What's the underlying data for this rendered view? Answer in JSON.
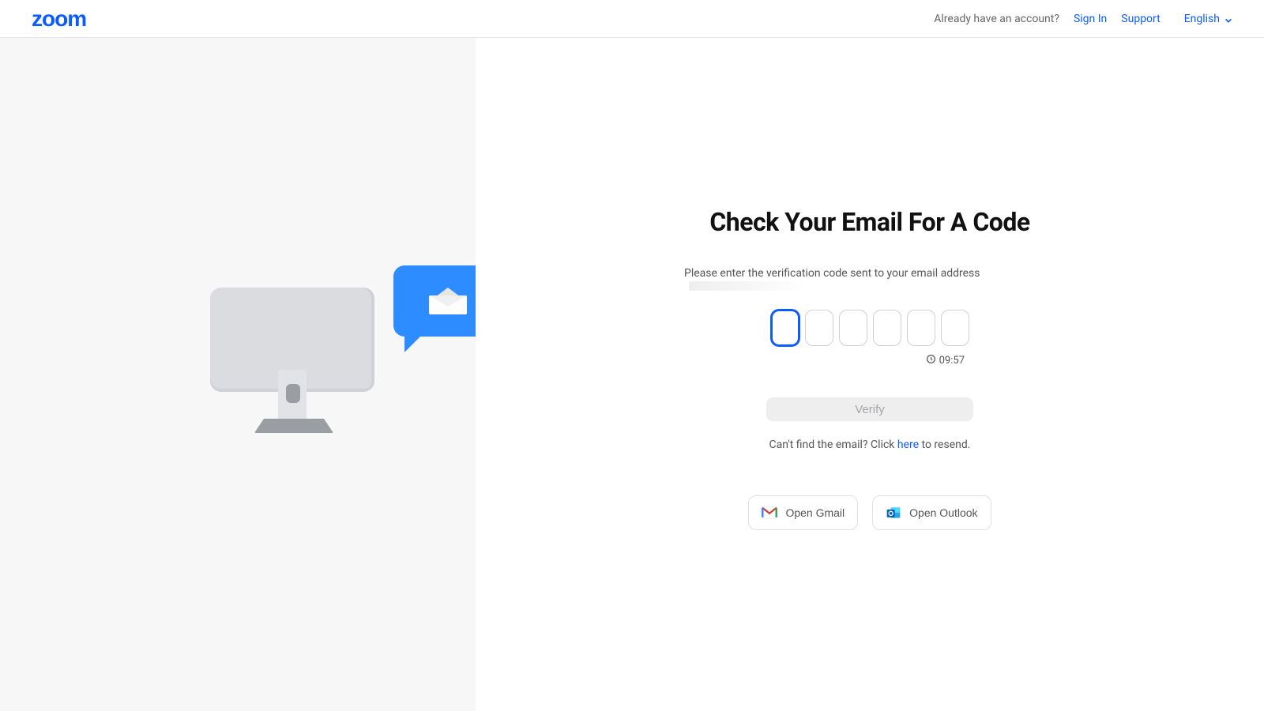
{
  "header": {
    "logo_text": "zoom",
    "account_prompt": "Already have an account?",
    "sign_in": "Sign In",
    "support": "Support",
    "language": "English"
  },
  "main": {
    "title": "Check Your Email For A Code",
    "instruction": "Please enter the verification code sent to your email address",
    "code_digits": 6,
    "code_values": [
      "",
      "",
      "",
      "",
      "",
      ""
    ],
    "timer": "09:57",
    "verify_label": "Verify",
    "resend_prefix": "Can't find the email? Click ",
    "resend_link": "here",
    "resend_suffix": " to resend.",
    "open_gmail": "Open Gmail",
    "open_outlook": "Open Outlook"
  },
  "colors": {
    "brand": "#0b5cff",
    "accent": "#2d8cff"
  }
}
